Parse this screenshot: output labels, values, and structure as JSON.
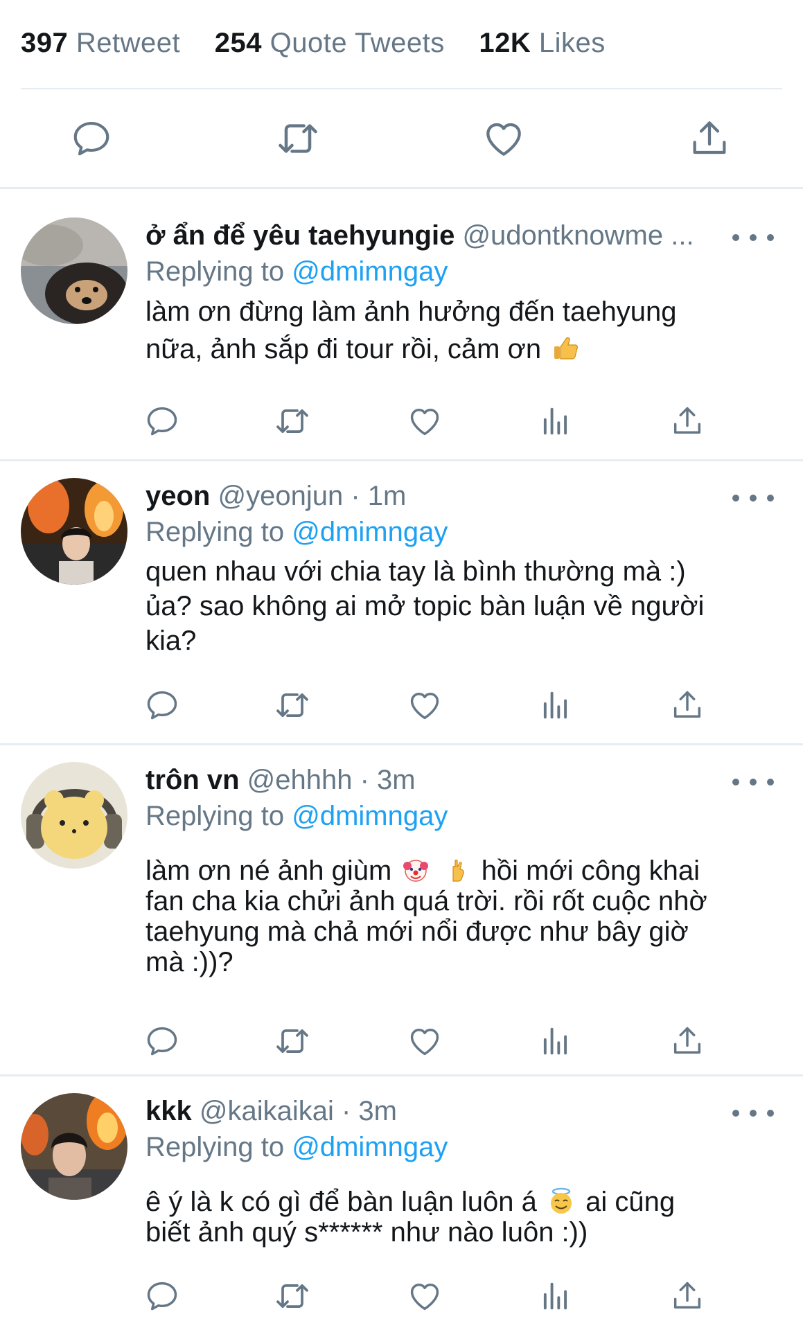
{
  "stats": {
    "retweet_count": "397",
    "retweet_label": "Retweet",
    "quote_count": "254",
    "quote_label": "Quote Tweets",
    "likes_count": "12K",
    "likes_label": "Likes"
  },
  "icons": {
    "reply": "reply-icon",
    "retweet": "retweet-icon",
    "like": "heart-icon",
    "views": "analytics-icon",
    "share": "share-icon",
    "more": "more-icon",
    "emoji_thumbs_up": "thumbs-up-emoji",
    "emoji_clown": "clown-emoji",
    "emoji_pinch": "pinching-hand-emoji",
    "emoji_angel": "smiling-face-with-halo-emoji"
  },
  "colors": {
    "link": "#1da1f2",
    "muted": "#657786",
    "text": "#14171a",
    "divider": "#e6ecf0"
  },
  "replies": [
    {
      "name": "ở ẩn để yêu taehyungie",
      "handle": "@udontknowme ...",
      "replying_prefix": "Replying to",
      "replying_to": "@dmimngay",
      "line1": "làm ơn đừng làm ảnh hưởng đến taehyung",
      "line2": "nữa, ảnh sắp đi tour rồi, cảm ơn"
    },
    {
      "name": "yeon",
      "handle": "@yeonjun · 1m",
      "replying_prefix": "Replying to",
      "replying_to": "@dmimngay",
      "line1": "quen nhau với chia tay là bình thường mà :)",
      "line2": "ủa? sao không ai mở topic bàn luận về người",
      "line3": "kia?"
    },
    {
      "name": "trôn vn",
      "handle": "@ehhhh · 3m",
      "replying_prefix": "Replying to",
      "replying_to": "@dmimngay",
      "line1a": "làm ơn né ảnh giùm",
      "line1b": "hồi mới công khai",
      "line2": "fan cha kia chửi ảnh quá trời. rồi rốt cuộc nhờ",
      "line3": "taehyung mà chả mới nổi được như bây giờ",
      "line4": "mà :))?"
    },
    {
      "name": "kkk",
      "handle": "@kaikaikai · 3m",
      "replying_prefix": "Replying to",
      "replying_to": "@dmimngay",
      "line1a": "ê ý là k có gì để bàn luận luôn á",
      "line1b": "ai cũng",
      "line2": "biết ảnh quý s****** như nào luôn :))"
    }
  ]
}
